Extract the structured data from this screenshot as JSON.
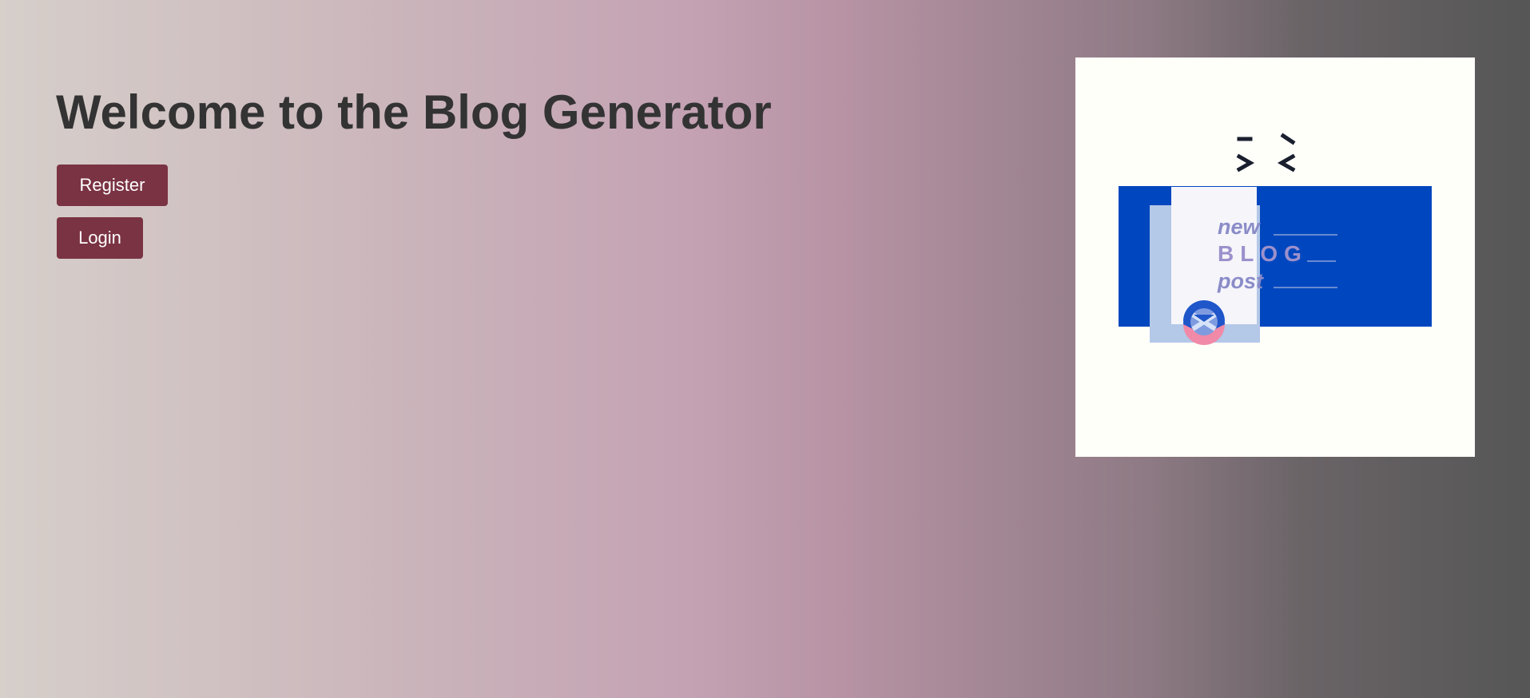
{
  "hero": {
    "title": "Welcome to the Blog Generator"
  },
  "actions": {
    "register_label": "Register",
    "login_label": "Login"
  },
  "illustration": {
    "line_1": "new",
    "line_2": "BLOG",
    "line_3": "post"
  },
  "colors": {
    "button": "#7a3343",
    "title": "#333333",
    "illustration_blue": "#0047bf"
  }
}
